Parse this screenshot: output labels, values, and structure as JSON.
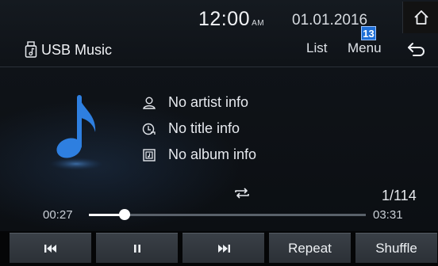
{
  "status": {
    "time": "12:00",
    "ampm": "AM",
    "date": "01.01.2016"
  },
  "header": {
    "title": "USB Music",
    "list_label": "List",
    "menu_label": "Menu",
    "menu_badge": "13"
  },
  "track": {
    "artist": "No artist info",
    "title": "No title info",
    "album": "No album info",
    "counter": "1/114",
    "elapsed": "00:27",
    "total": "03:31",
    "progress": 0.13
  },
  "controls": {
    "repeat_label": "Repeat",
    "shuffle_label": "Shuffle"
  },
  "icons": [
    "home-icon",
    "usb-icon",
    "back-icon",
    "music-note-icon",
    "artist-icon",
    "title-icon",
    "album-icon",
    "repeat-icon",
    "previous-icon",
    "pause-icon",
    "next-icon"
  ],
  "colors": {
    "accent": "#1f6fd6",
    "note": "#2e7fe0"
  }
}
